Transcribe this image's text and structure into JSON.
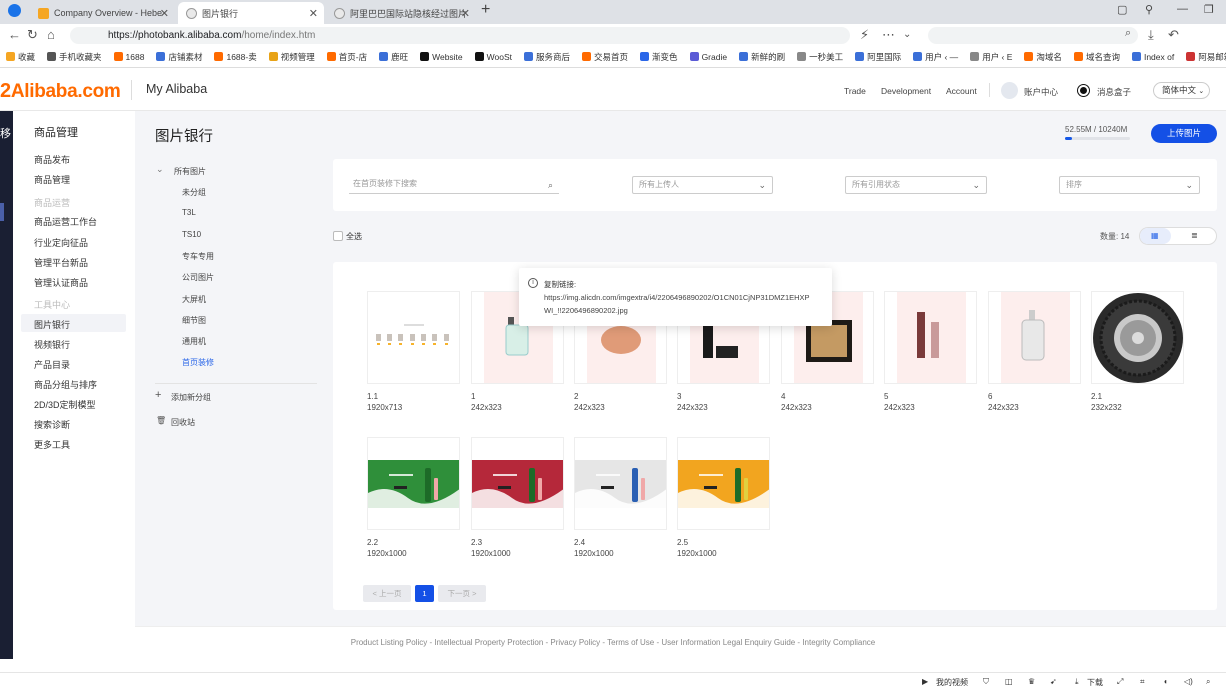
{
  "browser": {
    "tabs": [
      {
        "label": "Company Overview - Hebe",
        "favicon_color": "#f5a623"
      },
      {
        "label": "图片银行",
        "favicon_color": "#888888"
      },
      {
        "label": "阿里巴巴国际站隐核经过图片",
        "favicon_color": "#888888"
      }
    ],
    "url_host": "https://photobank.alibaba.com",
    "url_path": "/home/index.htm",
    "bookmarks": [
      "收藏",
      "手机收藏夹",
      "1688",
      "店铺素材",
      "1688-卖",
      "视频管理",
      "首页-店",
      "鹿旺",
      "Website",
      "WooSt",
      "服务商后",
      "交易首页",
      "渐变色",
      "Gradie",
      "新鲜的刷",
      "一秒美工",
      "阿里国际",
      "用户 ‹ —",
      "用户 ‹ E",
      "淘域名",
      "域名查询",
      "Index of",
      "阿易邮箱"
    ]
  },
  "header": {
    "logo": "Alibaba.com",
    "my_alibaba": "My Alibaba",
    "nav": [
      "Trade",
      "Development",
      "Account"
    ],
    "account_center": "账户中心",
    "message_box": "消息盒子",
    "language": "简体中文"
  },
  "dark_strip_label": "移",
  "sidebar": {
    "title": "商品管理",
    "items": [
      {
        "label": "商品发布",
        "muted": false
      },
      {
        "label": "商品管理",
        "muted": false
      },
      {
        "label": "商品运营",
        "muted": true
      },
      {
        "label": "商品运营工作台",
        "muted": false
      },
      {
        "label": "行业定向征品",
        "muted": false
      },
      {
        "label": "管理平台新品",
        "muted": false
      },
      {
        "label": "管理认证商品",
        "muted": false
      },
      {
        "label": "工具中心",
        "muted": true
      },
      {
        "label": "图片银行",
        "muted": false
      },
      {
        "label": "视频银行",
        "muted": false
      },
      {
        "label": "产品目录",
        "muted": false
      },
      {
        "label": "商品分组与排序",
        "muted": false
      },
      {
        "label": "2D/3D定制模型",
        "muted": false
      },
      {
        "label": "搜索诊断",
        "muted": false
      },
      {
        "label": "更多工具",
        "muted": false
      }
    ]
  },
  "main": {
    "title": "图片银行",
    "storage_text": "52.55M / 10240M",
    "storage_fraction": 0.005,
    "upload_label": "上传图片",
    "tree": {
      "root": "所有图片",
      "folders": [
        "未分组",
        "T3L",
        "TS10",
        "专车专用",
        "公司图片",
        "大屏机",
        "细节图",
        "通用机",
        "首页装修"
      ],
      "selected": "首页装修",
      "add_group": "添加新分组",
      "recycle": "回收站"
    },
    "filters": {
      "search_placeholder": "在首页装修下搜索",
      "uploader": "所有上传人",
      "reference": "所有引用状态",
      "sort": "排序"
    },
    "select_all": "全选",
    "count_text": "数量: 14",
    "tooltip": {
      "title": "复制链接:",
      "url": "https://img.alicdn.com/imgextra/i4/2206496890202/O1CN01CjNP31DMZ1EHXPWI_!!2206496890202.jpg"
    },
    "images": [
      {
        "name": "1.1",
        "size": "1920x713",
        "kind": "banner-white"
      },
      {
        "name": "1",
        "size": "242x323",
        "kind": "perfume"
      },
      {
        "name": "2",
        "size": "242x323",
        "kind": "sponge"
      },
      {
        "name": "3",
        "size": "242x323",
        "kind": "mascara"
      },
      {
        "name": "4",
        "size": "242x323",
        "kind": "powder"
      },
      {
        "name": "5",
        "size": "242x323",
        "kind": "lipgloss"
      },
      {
        "name": "6",
        "size": "242x323",
        "kind": "pump"
      },
      {
        "name": "2.1",
        "size": "232x232",
        "kind": "tire"
      },
      {
        "name": "2.2",
        "size": "1920x1000",
        "kind": "bev-green"
      },
      {
        "name": "2.3",
        "size": "1920x1000",
        "kind": "bev-red"
      },
      {
        "name": "2.4",
        "size": "1920x1000",
        "kind": "bev-white"
      },
      {
        "name": "2.5",
        "size": "1920x1000",
        "kind": "bev-orange"
      }
    ],
    "pager": {
      "prev": "< 上一页",
      "current": "1",
      "next": "下一页 >"
    }
  },
  "footer": "Product Listing Policy - Intellectual Property Protection - Privacy Policy - Terms of Use - User Information Legal Enquiry Guide - Integrity Compliance",
  "statusbar": {
    "my_video": "我的视频",
    "download": "下载"
  }
}
